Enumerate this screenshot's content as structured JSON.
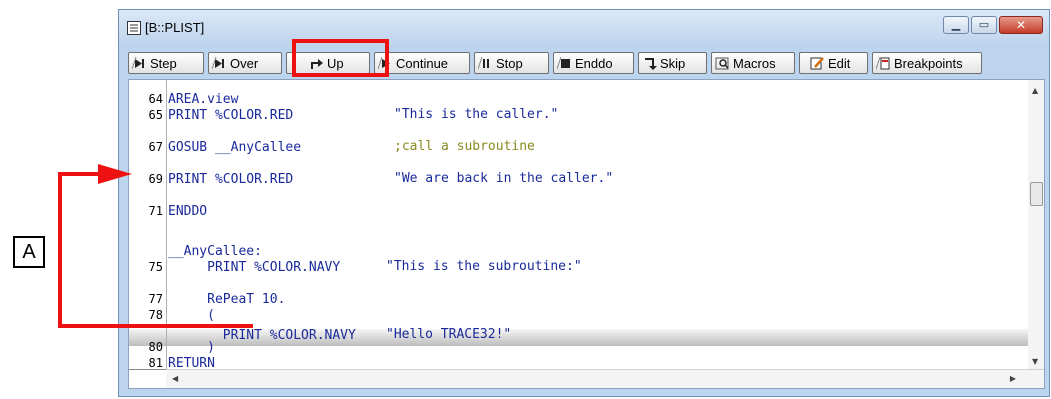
{
  "window": {
    "title": "[B::PLIST]",
    "buttons": [
      "minimize-icon",
      "maximize-icon",
      "close-icon"
    ]
  },
  "toolbar": [
    {
      "label": "Step",
      "icon": "step-icon"
    },
    {
      "label": "Over",
      "icon": "step-over-icon"
    },
    {
      "label": "Up",
      "icon": "step-up-icon"
    },
    {
      "label": "Continue",
      "icon": "continue-icon"
    },
    {
      "label": "Stop",
      "icon": "stop-icon"
    },
    {
      "label": "Enddo",
      "icon": "enddo-icon"
    },
    {
      "label": "Skip",
      "icon": "skip-icon"
    },
    {
      "label": "Macros",
      "icon": "macros-icon"
    },
    {
      "label": "Edit",
      "icon": "edit-icon"
    },
    {
      "label": "Breakpoints",
      "icon": "breakpoints-icon"
    }
  ],
  "code_lines": [
    {
      "num": "64",
      "code": "AREA.view",
      "arg": ""
    },
    {
      "num": "65",
      "code": "PRINT %COLOR.RED",
      "arg": "\"This is the caller.\""
    },
    {
      "num": "67",
      "code": "GOSUB __AnyCallee",
      "arg": ";call a subroutine"
    },
    {
      "num": "69",
      "code": "PRINT %COLOR.RED",
      "arg": "\"We are back in the caller.\""
    },
    {
      "num": "71",
      "code": "ENDDO",
      "arg": ""
    },
    {
      "num": "",
      "code": "__AnyCallee:",
      "arg": ""
    },
    {
      "num": "75",
      "code": "     PRINT %COLOR.NAVY",
      "arg": "\"This is the subroutine:\""
    },
    {
      "num": "77",
      "code": "     RePeaT 10.",
      "arg": ""
    },
    {
      "num": "78",
      "code": "     (",
      "arg": ""
    },
    {
      "num": "",
      "code": "       PRINT %COLOR.NAVY",
      "arg": "\"Hello TRACE32!\""
    },
    {
      "num": "80",
      "code": "     )",
      "arg": ""
    },
    {
      "num": "81",
      "code": "RETURN",
      "arg": ""
    }
  ],
  "annotation": {
    "label": "A",
    "highlight_color": "#e11111"
  }
}
